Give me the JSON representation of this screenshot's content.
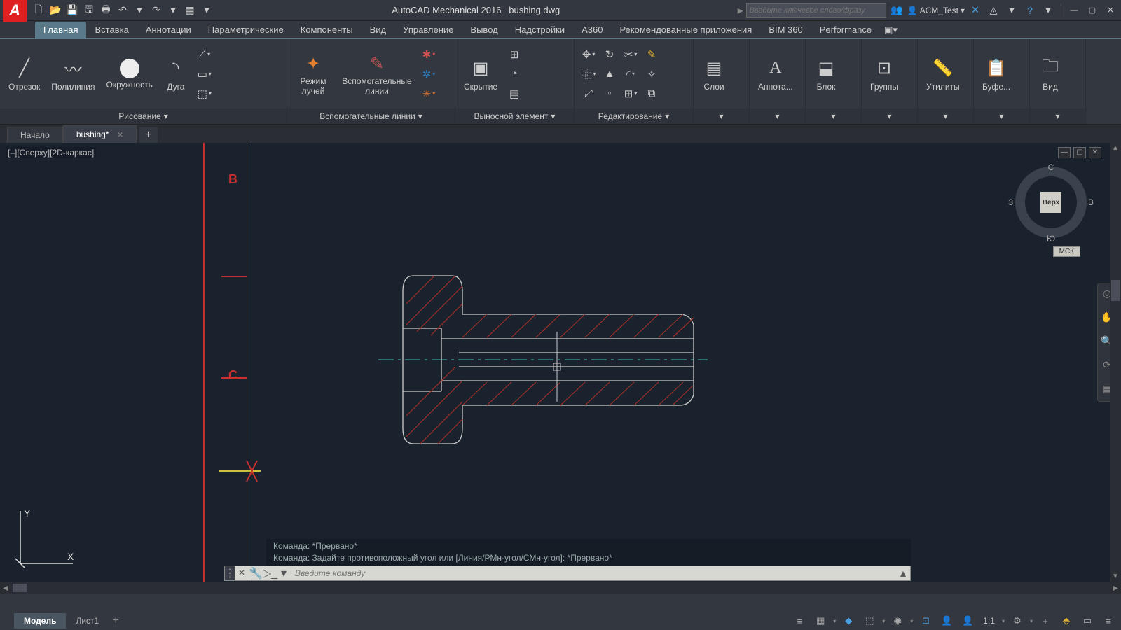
{
  "app": {
    "title": "AutoCAD Mechanical 2016",
    "file": "bushing.dwg"
  },
  "search": {
    "placeholder": "Введите ключевое слово/фразу"
  },
  "user": "ACM_Test",
  "ribbonTabs": [
    "Главная",
    "Вставка",
    "Аннотации",
    "Параметрические",
    "Компоненты",
    "Вид",
    "Управление",
    "Вывод",
    "Надстройки",
    "A360",
    "Рекомендованные приложения",
    "BIM 360",
    "Performance"
  ],
  "activeRibbonTab": 0,
  "panels": {
    "draw": {
      "title": "Рисование",
      "items": [
        "Отрезок",
        "Полилиния",
        "Окружность",
        "Дуга"
      ]
    },
    "aux": {
      "title": "Вспомогательные линии",
      "items": [
        "Режим лучей",
        "Вспомогательные линии"
      ]
    },
    "detail": {
      "title": "Выносной элемент",
      "items": [
        "Скрытие"
      ]
    },
    "edit": {
      "title": "Редактирование"
    },
    "layers": {
      "items": [
        "Слои"
      ]
    },
    "annotate": {
      "items": [
        "Аннота..."
      ]
    },
    "block": {
      "items": [
        "Блок"
      ]
    },
    "groups": {
      "items": [
        "Группы"
      ]
    },
    "utils": {
      "items": [
        "Утилиты"
      ]
    },
    "clip": {
      "items": [
        "Буфе..."
      ]
    },
    "view": {
      "items": [
        "Вид"
      ]
    }
  },
  "fileTabs": {
    "start": "Начало",
    "doc": "bushing*"
  },
  "viewportLabel": "[–][Сверху][2D-каркас]",
  "viewcube": {
    "face": "Верх",
    "n": "С",
    "s": "Ю",
    "e": "В",
    "w": "З",
    "wcs": "МСК"
  },
  "redLabels": {
    "b": "B",
    "c": "C"
  },
  "cmd": {
    "hist1": "Команда: *Прервано*",
    "hist2": "Команда: Задайте противоположный угол или [Линия/РМн-угол/СМн-угол]: *Прервано*",
    "placeholder": "Введите команду"
  },
  "bottomTabs": {
    "model": "Модель",
    "sheet": "Лист1"
  },
  "status": {
    "scale": "1:1"
  },
  "ucs": {
    "x": "X",
    "y": "Y"
  }
}
